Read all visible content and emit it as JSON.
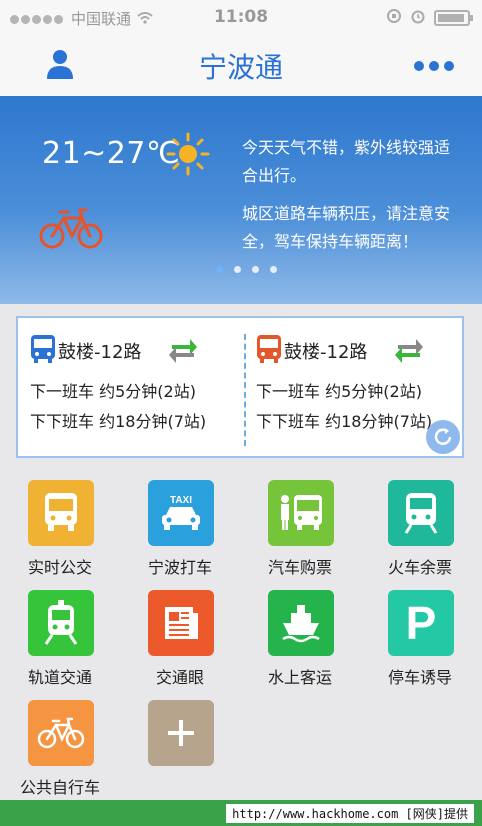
{
  "status_bar": {
    "carrier": "中国联通",
    "time": "11:08"
  },
  "nav": {
    "title": "宁波通"
  },
  "banner": {
    "temperature": "21~27℃",
    "text1": "今天天气不错，紫外线较强适合出行。",
    "text2": "城区道路车辆积压，请注意安全，驾车保持车辆距离！",
    "page_count": 4,
    "active_page": 0
  },
  "bus_card": {
    "left": {
      "route": "鼓楼-12路",
      "next_bus": "下一班车  约5分钟(2站)",
      "after_next_bus": "下下班车  约18分钟(7站)",
      "color": "#2a72d6"
    },
    "right": {
      "route": "鼓楼-12路",
      "next_bus": "下一班车  约5分钟(2站)",
      "after_next_bus": "下下班车  约18分钟(7站)",
      "color": "#e2582b"
    }
  },
  "services": [
    {
      "label": "实时公交",
      "icon": "bus-icon",
      "color": "#f0b232"
    },
    {
      "label": "宁波打车",
      "icon": "taxi-icon",
      "color": "#2aa0dd",
      "badge": "TAXI"
    },
    {
      "label": "汽车购票",
      "icon": "coach-ticket-icon",
      "color": "#76c43a"
    },
    {
      "label": "火车余票",
      "icon": "train-icon",
      "color": "#1fb89a"
    },
    {
      "label": "轨道交通",
      "icon": "metro-icon",
      "color": "#36c43a"
    },
    {
      "label": "交通眼",
      "icon": "newspaper-icon",
      "color": "#ec5a2c"
    },
    {
      "label": "水上客运",
      "icon": "ship-icon",
      "color": "#25b34b"
    },
    {
      "label": "停车诱导",
      "icon": "parking-icon",
      "color": "#25c8a5",
      "badge": "P"
    },
    {
      "label": "公共自行车",
      "icon": "bicycle-icon",
      "color": "#f59541"
    },
    {
      "label": "",
      "icon": "add-icon",
      "color": "#b6a48c"
    }
  ],
  "footer": {
    "watermark": "http://www.hackhome.com [网侠]提供"
  }
}
